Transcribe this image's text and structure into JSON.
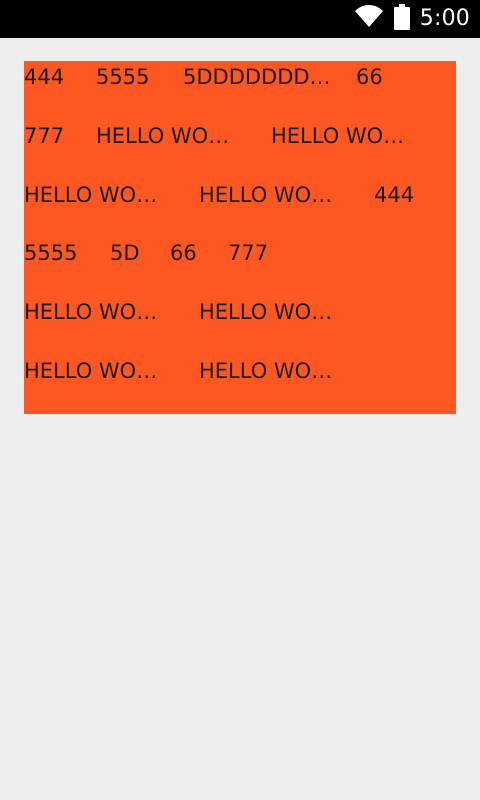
{
  "status_bar": {
    "time": "5:00",
    "icons": [
      "wifi-icon",
      "battery-icon"
    ],
    "background": "#000000",
    "foreground": "#ffffff"
  },
  "panel": {
    "background": "#ff5722",
    "rows": [
      [
        "444",
        "5555",
        "5DDDDDDD…",
        "66"
      ],
      [
        "777",
        "HELLO WO…",
        "HELLO WO…"
      ],
      [
        "HELLO WO…",
        "HELLO WO…",
        "444"
      ],
      [
        "5555",
        "5D",
        "66",
        "777"
      ],
      [
        "HELLO WO…",
        "HELLO WO…"
      ],
      [
        "HELLO WO…",
        "HELLO WO…"
      ]
    ]
  },
  "page": {
    "background": "#eeeeee"
  }
}
